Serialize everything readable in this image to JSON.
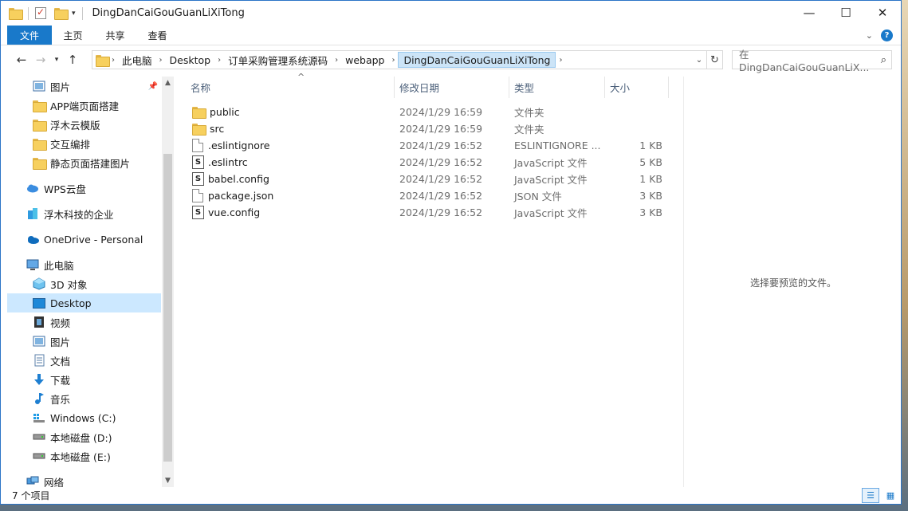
{
  "window": {
    "title": "DingDanCaiGouGuanLiXiTong",
    "controls": {
      "minimize": "—",
      "maximize": "☐",
      "close": "✕"
    }
  },
  "ribbon": {
    "file_tab": "文件",
    "tabs": [
      "主页",
      "共享",
      "查看"
    ]
  },
  "address": {
    "breadcrumbs": [
      "此电脑",
      "Desktop",
      "订单采购管理系统源码",
      "webapp",
      "DingDanCaiGouGuanLiXiTong"
    ],
    "search_placeholder": "在 DingDanCaiGouGuanLiX..."
  },
  "nav_pane": {
    "items": [
      {
        "label": "图片",
        "icon": "pictures-icon",
        "pinned": true
      },
      {
        "label": "APP端页面搭建",
        "icon": "folder-icon"
      },
      {
        "label": "浮木云模版",
        "icon": "folder-icon"
      },
      {
        "label": "交互编排",
        "icon": "folder-icon"
      },
      {
        "label": "静态页面搭建图片",
        "icon": "folder-icon"
      },
      {
        "label": "WPS云盘",
        "icon": "cloud-icon"
      },
      {
        "label": "浮木科技的企业",
        "icon": "enterprise-icon"
      },
      {
        "label": "OneDrive - Personal",
        "icon": "onedrive-icon"
      },
      {
        "label": "此电脑",
        "icon": "computer-icon"
      },
      {
        "label": "3D 对象",
        "icon": "3d-objects-icon"
      },
      {
        "label": "Desktop",
        "icon": "desktop-icon",
        "selected": true
      },
      {
        "label": "视频",
        "icon": "video-icon"
      },
      {
        "label": "图片",
        "icon": "pictures-icon"
      },
      {
        "label": "文档",
        "icon": "documents-icon"
      },
      {
        "label": "下载",
        "icon": "download-icon"
      },
      {
        "label": "音乐",
        "icon": "music-icon"
      },
      {
        "label": "Windows (C:)",
        "icon": "windows-drive-icon"
      },
      {
        "label": "本地磁盘 (D:)",
        "icon": "drive-icon"
      },
      {
        "label": "本地磁盘 (E:)",
        "icon": "drive-icon"
      },
      {
        "label": "网络",
        "icon": "network-icon"
      }
    ]
  },
  "file_list": {
    "columns": {
      "name": "名称",
      "date": "修改日期",
      "type": "类型",
      "size": "大小"
    },
    "rows": [
      {
        "name": "public",
        "date": "2024/1/29 16:59",
        "type": "文件夹",
        "size": "",
        "icon": "folder-icon"
      },
      {
        "name": "src",
        "date": "2024/1/29 16:59",
        "type": "文件夹",
        "size": "",
        "icon": "folder-icon"
      },
      {
        "name": ".eslintignore",
        "date": "2024/1/29 16:52",
        "type": "ESLINTIGNORE ...",
        "size": "1 KB",
        "icon": "file-icon"
      },
      {
        "name": ".eslintrc",
        "date": "2024/1/29 16:52",
        "type": "JavaScript 文件",
        "size": "5 KB",
        "icon": "js-file-icon"
      },
      {
        "name": "babel.config",
        "date": "2024/1/29 16:52",
        "type": "JavaScript 文件",
        "size": "1 KB",
        "icon": "js-file-icon"
      },
      {
        "name": "package.json",
        "date": "2024/1/29 16:52",
        "type": "JSON 文件",
        "size": "3 KB",
        "icon": "file-icon"
      },
      {
        "name": "vue.config",
        "date": "2024/1/29 16:52",
        "type": "JavaScript 文件",
        "size": "3 KB",
        "icon": "js-file-icon"
      }
    ]
  },
  "preview": {
    "message": "选择要预览的文件。"
  },
  "status": {
    "item_count": "7 个项目"
  },
  "colors": {
    "accent": "#1979ca",
    "selection": "#cce8ff",
    "header_text": "#4c607a"
  }
}
